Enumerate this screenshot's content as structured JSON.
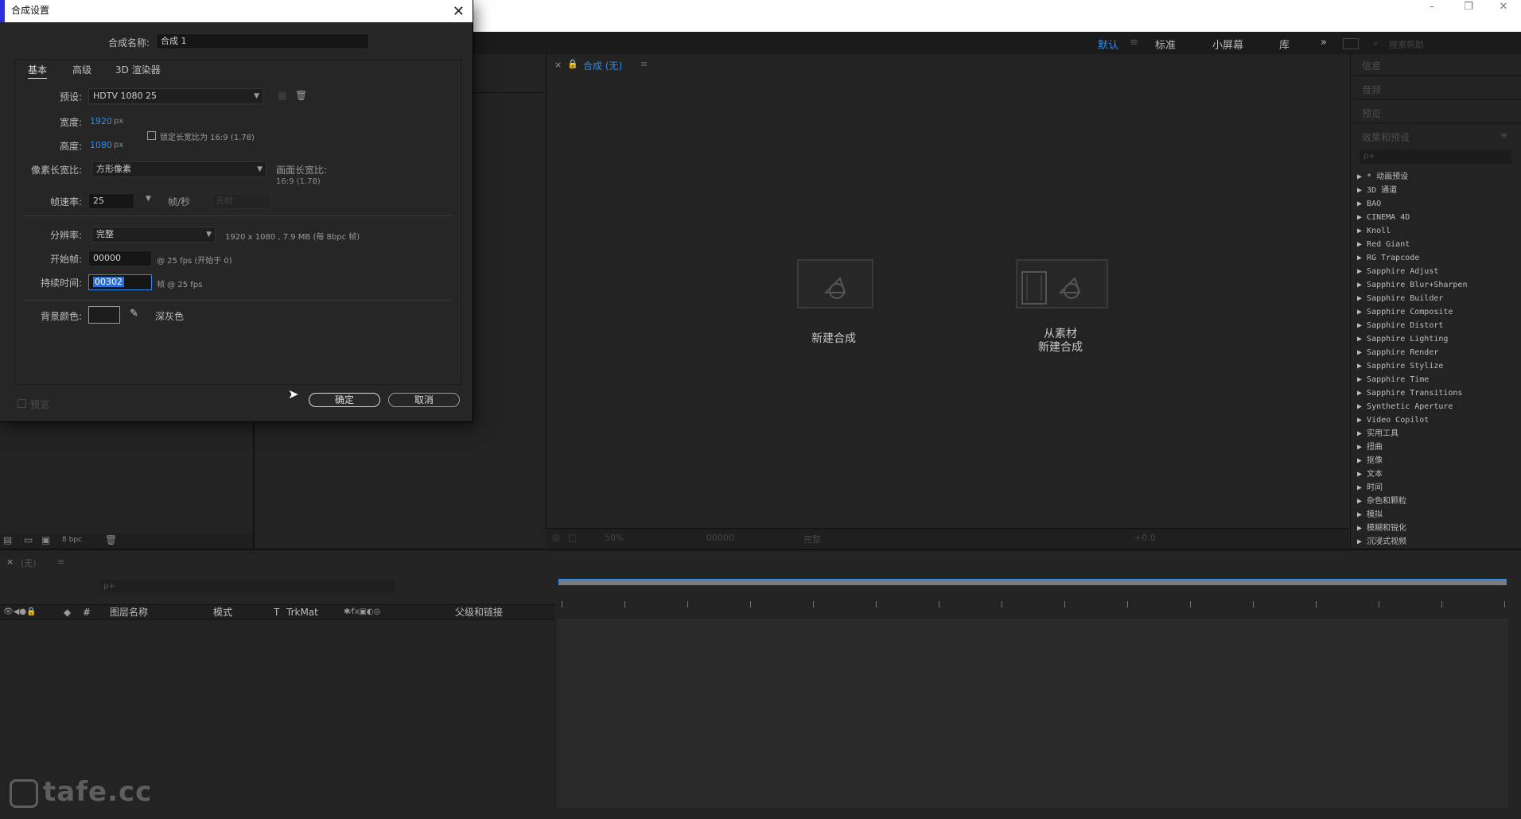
{
  "workspace": {
    "tabs": [
      "默认",
      "标准",
      "小屏幕",
      "库"
    ],
    "active_tab": "默认",
    "more": "»",
    "search_placeholder": "搜索帮助"
  },
  "viewer": {
    "tab_label": "合成 (无)",
    "new_comp_label": "新建合成",
    "from_footage_label_1": "从素材",
    "from_footage_label_2": "新建合成",
    "zoom": "50%",
    "timecode": "00000",
    "resolution": "完整",
    "offset": "+0.0"
  },
  "right_panel": {
    "headers": [
      "信息",
      "音频",
      "预览",
      "效果和预设"
    ],
    "effect_search_placeholder": "ρ+",
    "effects": [
      "* 动画预设",
      "3D 通道",
      "BAO",
      "CINEMA 4D",
      "Knoll",
      "Red Giant",
      "RG Trapcode",
      "Sapphire Adjust",
      "Sapphire Blur+Sharpen",
      "Sapphire Builder",
      "Sapphire Composite",
      "Sapphire Distort",
      "Sapphire Lighting",
      "Sapphire Render",
      "Sapphire Stylize",
      "Sapphire Time",
      "Sapphire Transitions",
      "Synthetic Aperture",
      "Video Copilot",
      "实用工具",
      "扭曲",
      "抠像",
      "文本",
      "时间",
      "杂色和颗粒",
      "模拟",
      "模糊和锐化",
      "沉浸式视频"
    ]
  },
  "project": {
    "bpc": "8 bpc"
  },
  "timeline": {
    "tab_label": "(无)",
    "columns": {
      "name": "图层名称",
      "mode": "模式",
      "t": "T",
      "trkmat": "TrkMat",
      "parent": "父级和链接",
      "hash": "#"
    }
  },
  "dialog": {
    "title": "合成设置",
    "close": "✕",
    "comp_name_label": "合成名称:",
    "comp_name_value": "合成 1",
    "tabs": [
      "基本",
      "高级",
      "3D 渲染器"
    ],
    "active_tab": "基本",
    "preset_label": "预设:",
    "preset_value": "HDTV 1080 25",
    "width_label": "宽度:",
    "width_value": "1920",
    "height_label": "高度:",
    "height_value": "1080",
    "px": "px",
    "lock_ratio_label": "锁定长宽比为 16:9 (1.78)",
    "pixel_aspect_label": "像素长宽比:",
    "pixel_aspect_value": "方形像素",
    "frame_aspect_label": "画面长宽比:",
    "frame_aspect_value": "16:9 (1.78)",
    "fps_label": "帧速率:",
    "fps_value": "25",
    "fps_unit": "帧/秒",
    "drop_frame": "丢帧",
    "resolution_label": "分辨率:",
    "resolution_value": "完整",
    "resolution_info": "1920 x 1080 , 7.9 MB (每 8bpc 帧)",
    "start_frame_label": "开始帧:",
    "start_frame_value": "00000",
    "start_frame_info": "@ 25 fps (开始于 0)",
    "duration_label": "持续时间:",
    "duration_value": "00302",
    "duration_info": "帧 @ 25 fps",
    "bg_color_label": "背景颜色:",
    "bg_color_name": "深灰色",
    "bg_color": "#1c1c1c",
    "preview_label": "预览",
    "ok_label": "确定",
    "cancel_label": "取消"
  },
  "watermark": "tafe.cc",
  "colors": {
    "accent": "#2d8ceb",
    "panel": "#232323",
    "dialog": "#262626"
  }
}
